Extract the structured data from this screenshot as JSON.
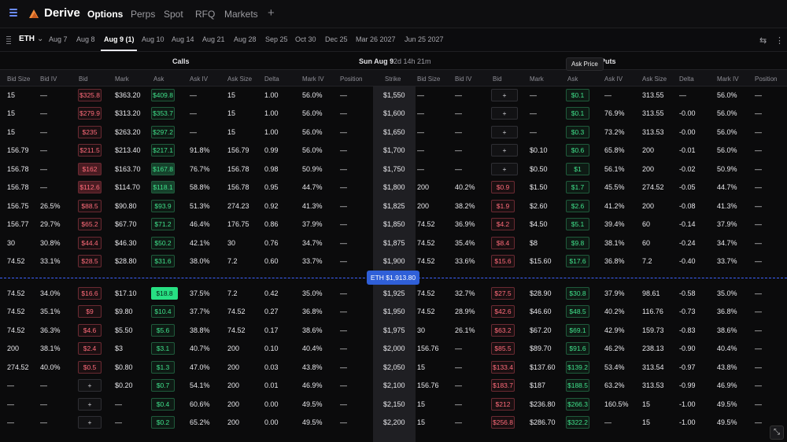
{
  "nav": {
    "brand": "Derive",
    "tabs": [
      "Options",
      "Perps",
      "Spot",
      "RFQ",
      "Markets"
    ],
    "add_tab": "+"
  },
  "expiry_bar": {
    "asset": "ETH",
    "expiries": [
      "Aug 7",
      "Aug 8",
      "Aug 9 (1)",
      "Aug 10",
      "Aug 14",
      "Aug 21",
      "Aug 28",
      "Sep 25",
      "Oct 30",
      "Dec 25",
      "Mar 26 2027",
      "Jun 25 2027"
    ],
    "active_index": 2
  },
  "sections": {
    "calls": "Calls",
    "expiry_label": "Sun Aug 9",
    "expiry_countdown": "2d 14h 21m",
    "puts": "Puts"
  },
  "tooltip": "Ask Price",
  "columns": {
    "calls": [
      "Bid Size",
      "Bid IV",
      "Bid",
      "Mark",
      "Ask",
      "Ask IV",
      "Ask Size",
      "Delta",
      "Mark IV",
      "Position"
    ],
    "strike": "Strike",
    "puts": [
      "Bid Size",
      "Bid IV",
      "Bid",
      "Mark",
      "Ask",
      "Ask IV",
      "Ask Size",
      "Delta",
      "Mark IV",
      "Position"
    ]
  },
  "eth_price": "ETH $1,913.80",
  "corner_icon": "expand-icon",
  "colors": {
    "bid": "#ff6b7a",
    "ask": "#3fe08a",
    "accent": "#2f5fd8"
  },
  "rows": [
    {
      "c": [
        "15",
        "—",
        "$325.8",
        "$363.20",
        "$409.8",
        "—",
        "15",
        "1.00",
        "56.0%",
        "—"
      ],
      "strike": "$1,550",
      "p": [
        "—",
        "—",
        "+",
        "—",
        "$0.1",
        "—",
        "313.55",
        "—",
        "56.0%",
        "—"
      ]
    },
    {
      "c": [
        "15",
        "—",
        "$279.9",
        "$313.20",
        "$353.7",
        "—",
        "15",
        "1.00",
        "56.0%",
        "—"
      ],
      "strike": "$1,600",
      "p": [
        "—",
        "—",
        "+",
        "—",
        "$0.1",
        "76.9%",
        "313.55",
        "-0.00",
        "56.0%",
        "—"
      ]
    },
    {
      "c": [
        "15",
        "—",
        "$235",
        "$263.20",
        "$297.2",
        "—",
        "15",
        "1.00",
        "56.0%",
        "—"
      ],
      "strike": "$1,650",
      "p": [
        "—",
        "—",
        "+",
        "—",
        "$0.3",
        "73.2%",
        "313.53",
        "-0.00",
        "56.0%",
        "—"
      ]
    },
    {
      "c": [
        "156.79",
        "—",
        "$211.5",
        "$213.40",
        "$217.1",
        "91.8%",
        "156.79",
        "0.99",
        "56.0%",
        "—"
      ],
      "strike": "$1,700",
      "p": [
        "—",
        "—",
        "+",
        "$0.10",
        "$0.6",
        "65.8%",
        "200",
        "-0.01",
        "56.0%",
        "—"
      ]
    },
    {
      "c": [
        "156.78",
        "—",
        "$162",
        "$163.70",
        "$167.8",
        "76.7%",
        "156.78",
        "0.98",
        "50.9%",
        "—"
      ],
      "strike": "$1,750",
      "p": [
        "—",
        "—",
        "+",
        "$0.50",
        "$1",
        "56.1%",
        "200",
        "-0.02",
        "50.9%",
        "—"
      ]
    },
    {
      "c": [
        "156.78",
        "—",
        "$112.6",
        "$114.70",
        "$118.1",
        "58.8%",
        "156.78",
        "0.95",
        "44.7%",
        "—"
      ],
      "strike": "$1,800",
      "p": [
        "200",
        "40.2%",
        "$0.9",
        "$1.50",
        "$1.7",
        "45.5%",
        "274.52",
        "-0.05",
        "44.7%",
        "—"
      ]
    },
    {
      "c": [
        "156.75",
        "26.5%",
        "$88.5",
        "$90.80",
        "$93.9",
        "51.3%",
        "274.23",
        "0.92",
        "41.3%",
        "—"
      ],
      "strike": "$1,825",
      "p": [
        "200",
        "38.2%",
        "$1.9",
        "$2.60",
        "$2.6",
        "41.2%",
        "200",
        "-0.08",
        "41.3%",
        "—"
      ]
    },
    {
      "c": [
        "156.77",
        "29.7%",
        "$65.2",
        "$67.70",
        "$71.2",
        "46.4%",
        "176.75",
        "0.86",
        "37.9%",
        "—"
      ],
      "strike": "$1,850",
      "p": [
        "74.52",
        "36.9%",
        "$4.2",
        "$4.50",
        "$5.1",
        "39.4%",
        "60",
        "-0.14",
        "37.9%",
        "—"
      ]
    },
    {
      "c": [
        "30",
        "30.8%",
        "$44.4",
        "$46.30",
        "$50.2",
        "42.1%",
        "30",
        "0.76",
        "34.7%",
        "—"
      ],
      "strike": "$1,875",
      "p": [
        "74.52",
        "35.4%",
        "$8.4",
        "$8",
        "$9.8",
        "38.1%",
        "60",
        "-0.24",
        "34.7%",
        "—"
      ]
    },
    {
      "c": [
        "74.52",
        "33.1%",
        "$28.5",
        "$28.80",
        "$31.6",
        "38.0%",
        "7.2",
        "0.60",
        "33.7%",
        "—"
      ],
      "strike": "$1,900",
      "p": [
        "74.52",
        "33.6%",
        "$15.6",
        "$15.60",
        "$17.6",
        "36.8%",
        "7.2",
        "-0.40",
        "33.7%",
        "—"
      ]
    },
    {
      "c": [
        "74.52",
        "34.0%",
        "$16.6",
        "$17.10",
        "$18.8",
        "37.5%",
        "7.2",
        "0.42",
        "35.0%",
        "—"
      ],
      "strike": "$1,925",
      "p": [
        "74.52",
        "32.7%",
        "$27.5",
        "$28.90",
        "$30.8",
        "37.9%",
        "98.61",
        "-0.58",
        "35.0%",
        "—"
      ]
    },
    {
      "c": [
        "74.52",
        "35.1%",
        "$9",
        "$9.80",
        "$10.4",
        "37.7%",
        "74.52",
        "0.27",
        "36.8%",
        "—"
      ],
      "strike": "$1,950",
      "p": [
        "74.52",
        "28.9%",
        "$42.6",
        "$46.60",
        "$48.5",
        "40.2%",
        "116.76",
        "-0.73",
        "36.8%",
        "—"
      ]
    },
    {
      "c": [
        "74.52",
        "36.3%",
        "$4.6",
        "$5.50",
        "$5.6",
        "38.8%",
        "74.52",
        "0.17",
        "38.6%",
        "—"
      ],
      "strike": "$1,975",
      "p": [
        "30",
        "26.1%",
        "$63.2",
        "$67.20",
        "$69.1",
        "42.9%",
        "159.73",
        "-0.83",
        "38.6%",
        "—"
      ]
    },
    {
      "c": [
        "200",
        "38.1%",
        "$2.4",
        "$3",
        "$3.1",
        "40.7%",
        "200",
        "0.10",
        "40.4%",
        "—"
      ],
      "strike": "$2,000",
      "p": [
        "156.76",
        "—",
        "$85.5",
        "$89.70",
        "$91.6",
        "46.2%",
        "238.13",
        "-0.90",
        "40.4%",
        "—"
      ]
    },
    {
      "c": [
        "274.52",
        "40.0%",
        "$0.5",
        "$0.80",
        "$1.3",
        "47.0%",
        "200",
        "0.03",
        "43.8%",
        "—"
      ],
      "strike": "$2,050",
      "p": [
        "15",
        "—",
        "$133.4",
        "$137.60",
        "$139.2",
        "53.4%",
        "313.54",
        "-0.97",
        "43.8%",
        "—"
      ]
    },
    {
      "c": [
        "—",
        "—",
        "+",
        "$0.20",
        "$0.7",
        "54.1%",
        "200",
        "0.01",
        "46.9%",
        "—"
      ],
      "strike": "$2,100",
      "p": [
        "156.76",
        "—",
        "$183.7",
        "$187",
        "$188.5",
        "63.2%",
        "313.53",
        "-0.99",
        "46.9%",
        "—"
      ]
    },
    {
      "c": [
        "—",
        "—",
        "+",
        "—",
        "$0.4",
        "60.6%",
        "200",
        "0.00",
        "49.5%",
        "—"
      ],
      "strike": "$2,150",
      "p": [
        "15",
        "—",
        "$212",
        "$236.80",
        "$266.3",
        "160.5%",
        "15",
        "-1.00",
        "49.5%",
        "—"
      ]
    },
    {
      "c": [
        "—",
        "—",
        "+",
        "—",
        "$0.2",
        "65.2%",
        "200",
        "0.00",
        "49.5%",
        "—"
      ],
      "strike": "$2,200",
      "p": [
        "15",
        "—",
        "$256.8",
        "$286.70",
        "$322.2",
        "—",
        "15",
        "-1.00",
        "49.5%",
        "—"
      ]
    }
  ]
}
